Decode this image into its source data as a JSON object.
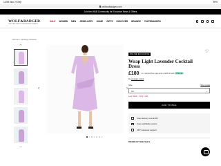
{
  "status_bar": {
    "time": "14:58  Mon 23 Sep",
    "battery": "89%"
  },
  "browser": {
    "url": "wolfandbadger.com"
  },
  "promo": {
    "text": "Join the W&B Community for Exclusive News & Offers"
  },
  "header": {
    "logo": "WOLF&BADGER",
    "tagline": "THE PLATFORM FOR INDEPENDENT BRANDS",
    "nav": [
      "SALE",
      "WOMEN",
      "MEN",
      "JEWELLERY",
      "HOME",
      "GIFTS",
      "DISCOVER",
      "BRANDS",
      "TASTEMAKERS"
    ]
  },
  "breadcrumb": "Women / Clothing / Dresses",
  "product": {
    "badge": "ONLINE EXCLUSIVE",
    "title": "Wrap Light Lavender Cocktail Dress",
    "price": "£180",
    "klarna_text": "or 4 interest-free payments of £45.00 with",
    "klarna_brand": "clearpay",
    "by_label": "By",
    "brand": "concept a trois",
    "size_label": "Size",
    "size_guide": "Size Guide",
    "size_value": "XS",
    "stock": "Low Stock - Only 1 left",
    "add_to_bag": "ADD TO BAG",
    "info": [
      "Free delivery over £150",
      "Free worldwide returns",
      "24/7 customer support"
    ],
    "details_heading": "PRODUCT DETAILS"
  },
  "gallery": {
    "images": 7,
    "current": 1
  },
  "colors": {
    "accent": "#c8102e",
    "dress": "#dcb8e6",
    "button": "#000000"
  }
}
